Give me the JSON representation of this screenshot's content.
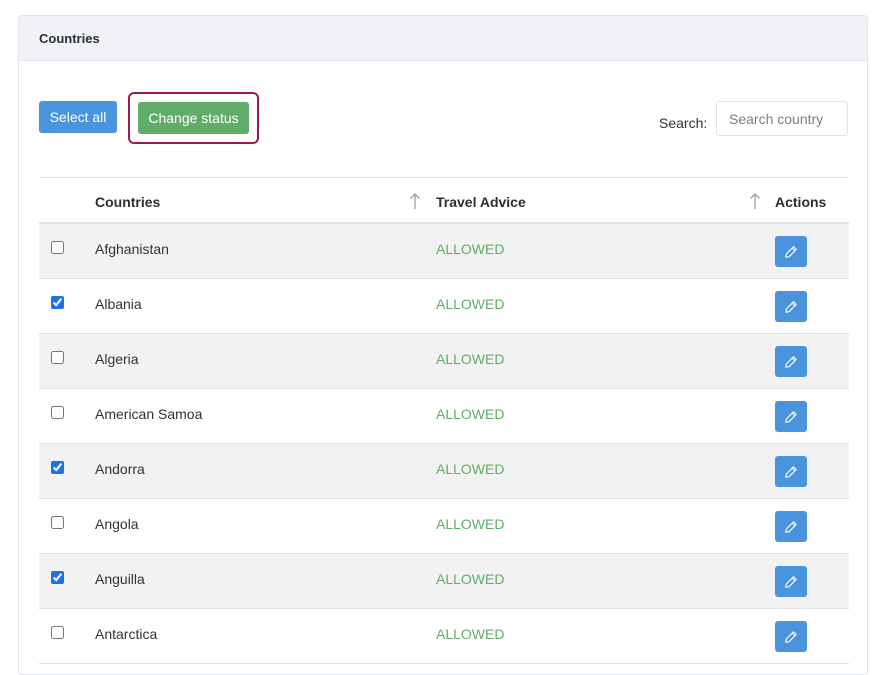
{
  "card": {
    "title": "Countries"
  },
  "toolbar": {
    "select_all_label": "Select all",
    "change_status_label": "Change status",
    "search_label": "Search:",
    "search_placeholder": "Search country",
    "search_value": ""
  },
  "table": {
    "columns": [
      "Countries",
      "Travel Advice",
      "Actions"
    ],
    "rows": [
      {
        "name": "Afghanistan",
        "status": "ALLOWED",
        "checked": false
      },
      {
        "name": "Albania",
        "status": "ALLOWED",
        "checked": true
      },
      {
        "name": "Algeria",
        "status": "ALLOWED",
        "checked": false
      },
      {
        "name": "American Samoa",
        "status": "ALLOWED",
        "checked": false
      },
      {
        "name": "Andorra",
        "status": "ALLOWED",
        "checked": true
      },
      {
        "name": "Angola",
        "status": "ALLOWED",
        "checked": false
      },
      {
        "name": "Anguilla",
        "status": "ALLOWED",
        "checked": true
      },
      {
        "name": "Antarctica",
        "status": "ALLOWED",
        "checked": false
      }
    ]
  },
  "icons": {
    "sort": "sort-arrow-up-icon",
    "edit": "pencil-icon"
  },
  "colors": {
    "primary": "#4a94de",
    "success": "#5fad68",
    "highlight_border": "#9c1a4f",
    "header_bg": "#f0f2f5",
    "stripe_bg": "#f2f2f2"
  }
}
